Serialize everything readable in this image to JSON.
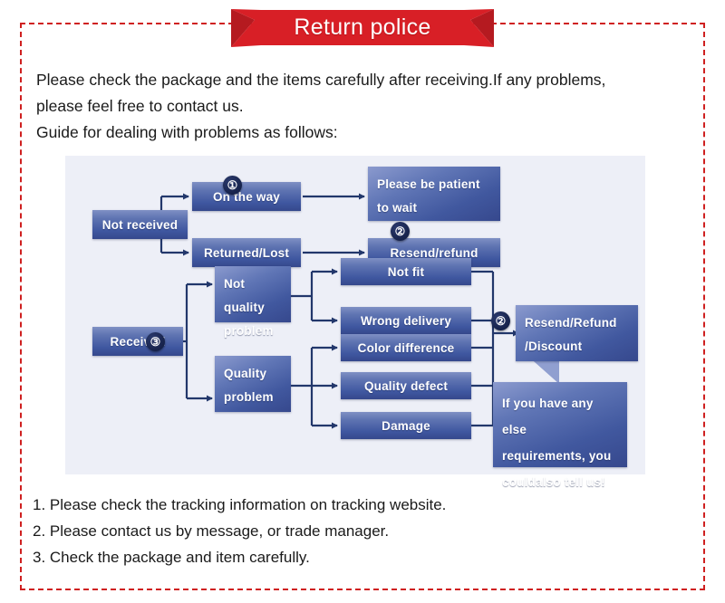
{
  "banner": {
    "title": "Return police",
    "color": "#d81f26"
  },
  "frame": {
    "border_color": "#cf2020"
  },
  "intro": {
    "lines": [
      "Please check the package and the items carefully after receiving.If any problems,",
      "please feel free to contact us.",
      "Guide for dealing with problems as follows:"
    ]
  },
  "flowchart": {
    "background": "#edeff7",
    "box_color": "#4257a0",
    "nodes": {
      "not_received": "Not received",
      "on_the_way": "On the way",
      "returned_lost": "Returned/Lost",
      "please_be_patient_l1": "Please be patient",
      "please_be_patient_l2": "to wait",
      "resend_refund": "Resend/refund",
      "received": "Received",
      "not_quality_l1": "Not quality",
      "not_quality_l2": "problem",
      "quality_l1": "Quality",
      "quality_l2": "problem",
      "not_fit": "Not fit",
      "wrong_delivery": "Wrong delivery",
      "color_difference": "Color difference",
      "quality_defect": "Quality defect",
      "damage": "Damage",
      "resend_refund_discount_l1": "Resend/Refund",
      "resend_refund_discount_l2": "/Discount",
      "callout_l1": "If you have any else",
      "callout_l2": "requirements, you",
      "callout_l3": "couldalso tell us!"
    },
    "steps": {
      "one": "①",
      "two_top": "②",
      "two_right": "②",
      "three": "③"
    }
  },
  "notes": {
    "items": [
      "1. Please check the tracking information on tracking website.",
      "2. Please contact us by message, or trade manager.",
      "3. Check the package and item carefully."
    ]
  }
}
